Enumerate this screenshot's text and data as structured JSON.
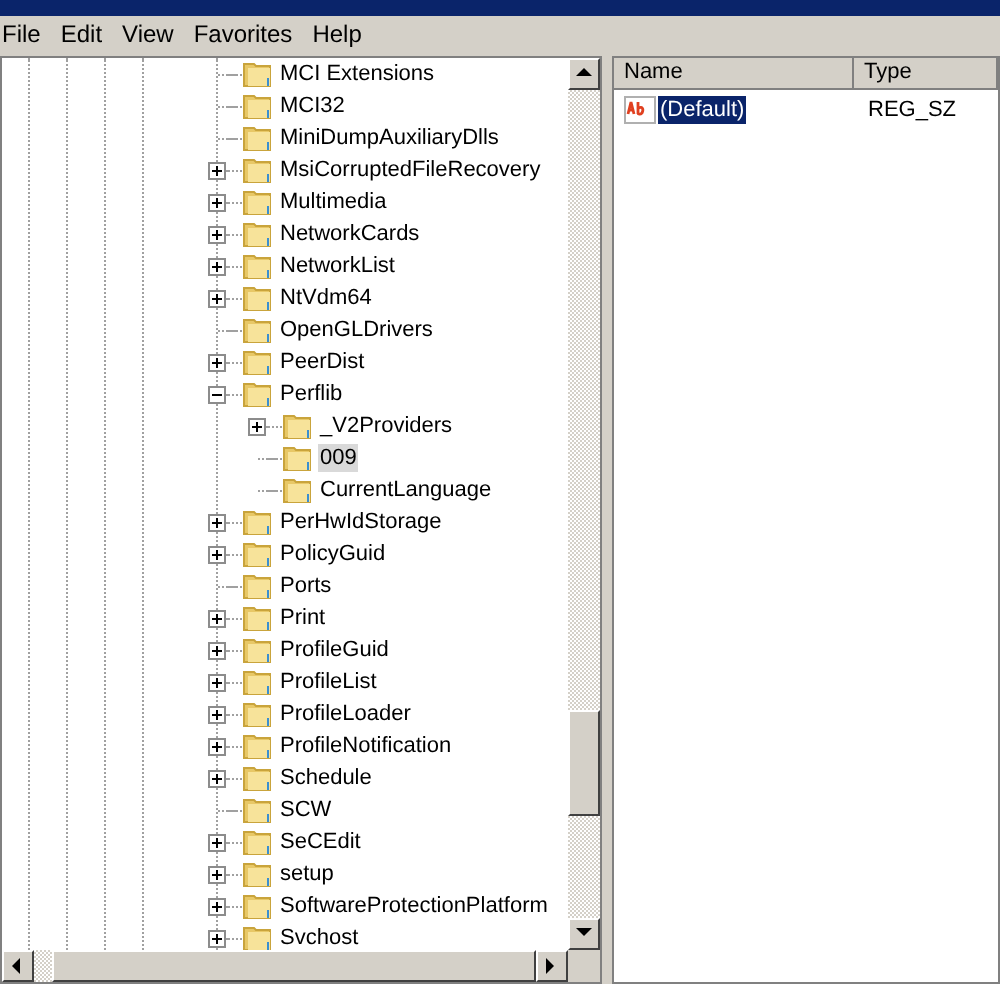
{
  "menu": [
    "File",
    "Edit",
    "View",
    "Favorites",
    "Help"
  ],
  "tree": {
    "items": [
      {
        "label": "MCI Extensions",
        "kind": "leaf",
        "selected": false
      },
      {
        "label": "MCI32",
        "kind": "leaf",
        "selected": false
      },
      {
        "label": "MiniDumpAuxiliaryDlls",
        "kind": "leaf",
        "selected": false
      },
      {
        "label": "MsiCorruptedFileRecovery",
        "kind": "node",
        "expanded": false,
        "selected": false
      },
      {
        "label": "Multimedia",
        "kind": "node",
        "expanded": false,
        "selected": false
      },
      {
        "label": "NetworkCards",
        "kind": "node",
        "expanded": false,
        "selected": false
      },
      {
        "label": "NetworkList",
        "kind": "node",
        "expanded": false,
        "selected": false
      },
      {
        "label": "NtVdm64",
        "kind": "node",
        "expanded": false,
        "selected": false
      },
      {
        "label": "OpenGLDrivers",
        "kind": "leaf",
        "selected": false
      },
      {
        "label": "PeerDist",
        "kind": "node",
        "expanded": false,
        "selected": false
      },
      {
        "label": "Perflib",
        "kind": "node",
        "expanded": true,
        "selected": false,
        "children": [
          {
            "label": "_V2Providers",
            "kind": "node",
            "expanded": false,
            "selected": false
          },
          {
            "label": "009",
            "kind": "leaf",
            "selected": true
          },
          {
            "label": "CurrentLanguage",
            "kind": "leaf",
            "selected": false
          }
        ]
      },
      {
        "label": "PerHwIdStorage",
        "kind": "node",
        "expanded": false,
        "selected": false
      },
      {
        "label": "PolicyGuid",
        "kind": "node",
        "expanded": false,
        "selected": false
      },
      {
        "label": "Ports",
        "kind": "leaf",
        "selected": false
      },
      {
        "label": "Print",
        "kind": "node",
        "expanded": false,
        "selected": false
      },
      {
        "label": "ProfileGuid",
        "kind": "node",
        "expanded": false,
        "selected": false
      },
      {
        "label": "ProfileList",
        "kind": "node",
        "expanded": false,
        "selected": false
      },
      {
        "label": "ProfileLoader",
        "kind": "node",
        "expanded": false,
        "selected": false
      },
      {
        "label": "ProfileNotification",
        "kind": "node",
        "expanded": false,
        "selected": false
      },
      {
        "label": "Schedule",
        "kind": "node",
        "expanded": false,
        "selected": false
      },
      {
        "label": "SCW",
        "kind": "leaf",
        "selected": false
      },
      {
        "label": "SeCEdit",
        "kind": "node",
        "expanded": false,
        "selected": false
      },
      {
        "label": "setup",
        "kind": "node",
        "expanded": false,
        "selected": false
      },
      {
        "label": "SoftwareProtectionPlatform",
        "kind": "node",
        "expanded": false,
        "selected": false
      },
      {
        "label": "Svchost",
        "kind": "node",
        "expanded": false,
        "selected": false
      }
    ]
  },
  "values": {
    "columns": [
      "Name",
      "Type"
    ],
    "rows": [
      {
        "name": "(Default)",
        "type": "REG_SZ",
        "selected": true
      }
    ]
  }
}
